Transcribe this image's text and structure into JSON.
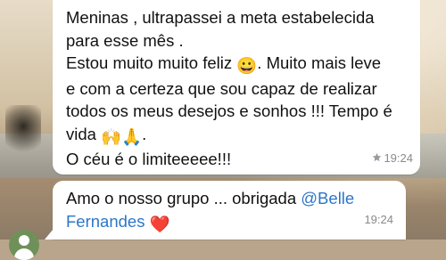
{
  "messages": [
    {
      "lines": [
        "Meninas , ultrapassei a meta estabelecida",
        "para esse mês .",
        "Estou muito muito feliz ",
        ". Muito mais leve",
        "e com a certeza que sou capaz de realizar",
        "todos os meus desejos e sonhos !!! Tempo é",
        "vida ",
        ".",
        "O céu é o limiteeeee!!!"
      ],
      "emojis": [
        "😀",
        "🙌",
        "🙏"
      ],
      "starred": true,
      "time": "19:24"
    },
    {
      "text_before": "Amo o nosso grupo ... obrigada ",
      "mention": "@Belle Fernandes",
      "emoji": "❤️",
      "time": "19:24"
    }
  ],
  "icons": {
    "star": "star-icon",
    "avatar": "default-user-avatar-icon"
  },
  "colors": {
    "bubble": "#ffffff",
    "mention": "#2d76c8",
    "timestamp": "#8a8a8a",
    "avatar_bg": "#6f9159"
  }
}
